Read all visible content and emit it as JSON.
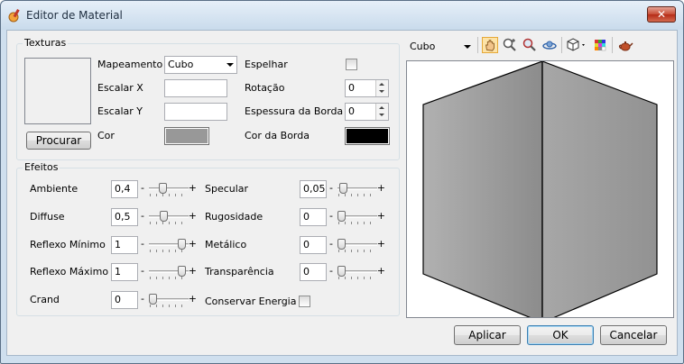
{
  "window": {
    "title": "Editor de Material",
    "close_glyph": "✕"
  },
  "texturas": {
    "legend": "Texturas",
    "browse_label": "Procurar",
    "mapeamento_label": "Mapeamento",
    "mapeamento_value": "Cubo",
    "escalar_x_label": "Escalar X",
    "escalar_x_value": "",
    "escalar_y_label": "Escalar Y",
    "escalar_y_value": "",
    "cor_label": "Cor",
    "cor_color": "#989898",
    "espelhar_label": "Espelhar",
    "espelhar_checked": false,
    "rotacao_label": "Rotação",
    "rotacao_value": "0",
    "espessura_label": "Espessura da Borda",
    "espessura_value": "0",
    "cor_borda_label": "Cor da Borda",
    "cor_borda_color": "#000000"
  },
  "efeitos": {
    "legend": "Efeitos",
    "left": [
      {
        "label": "Ambiente",
        "value": "0,4",
        "level": 0.3
      },
      {
        "label": "Diffuse",
        "value": "0,5",
        "level": 0.35
      },
      {
        "label": "Reflexo Mínimo",
        "value": "1",
        "level": 0.9
      },
      {
        "label": "Reflexo Máximo",
        "value": "1",
        "level": 0.9
      },
      {
        "label": "Crand",
        "value": "0",
        "level": 0.0
      }
    ],
    "right": [
      {
        "label": "Specular",
        "value": "0,05",
        "level": 0.05
      },
      {
        "label": "Rugosidade",
        "value": "0",
        "level": 0.0
      },
      {
        "label": "Metálico",
        "value": "0",
        "level": 0.0
      },
      {
        "label": "Transparência",
        "value": "0",
        "level": 0.0
      }
    ],
    "conservar_label": "Conservar Energia",
    "conservar_checked": false
  },
  "preview": {
    "shape_value": "Cubo",
    "toolbar_icons": [
      "pan-hand-icon",
      "zoom-in-icon",
      "zoom-icon",
      "orbit-icon",
      "view-cube-icon",
      "color-palette-icon",
      "teapot-icon"
    ],
    "face_color": "#9a9a9a"
  },
  "buttons": {
    "apply": "Aplicar",
    "ok": "OK",
    "cancel": "Cancelar"
  }
}
